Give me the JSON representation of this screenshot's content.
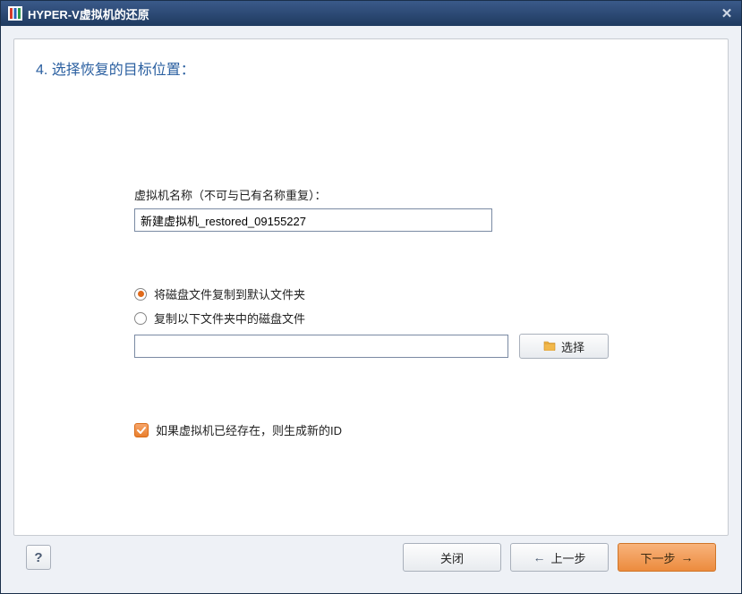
{
  "window": {
    "title": "HYPER-V虚拟机的还原"
  },
  "step": {
    "number": "4.",
    "title": "选择恢复的目标位置："
  },
  "form": {
    "vm_name_label": "虚拟机名称（不可与已有名称重复）：",
    "vm_name_value": "新建虚拟机_restored_09155227",
    "radio_default_folder": "将磁盘文件复制到默认文件夹",
    "radio_custom_folder": "复制以下文件夹中的磁盘文件",
    "path_value": "",
    "select_button": "选择",
    "checkbox_generate_id": "如果虚拟机已经存在，则生成新的ID",
    "radio_selected": "default",
    "checkbox_checked": true
  },
  "footer": {
    "help": "?",
    "close": "关闭",
    "prev": "上一步",
    "next": "下一步"
  }
}
